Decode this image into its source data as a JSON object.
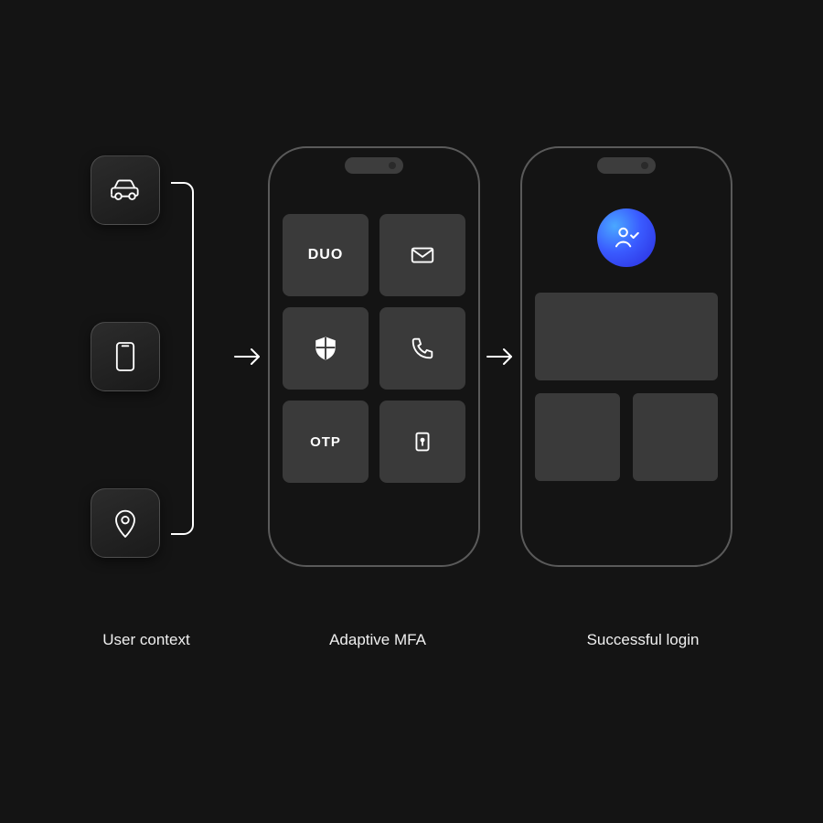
{
  "columns": {
    "context": {
      "label": "User context",
      "tiles": [
        "car",
        "phone-device",
        "location-pin"
      ]
    },
    "mfa": {
      "label": "Adaptive MFA",
      "tiles": [
        {
          "icon": "duo",
          "text": "DUO"
        },
        {
          "icon": "mail"
        },
        {
          "icon": "shield"
        },
        {
          "icon": "phone-call"
        },
        {
          "icon": "otp",
          "text": "OTP"
        },
        {
          "icon": "lock-key"
        }
      ]
    },
    "success": {
      "label": "Successful login"
    }
  }
}
